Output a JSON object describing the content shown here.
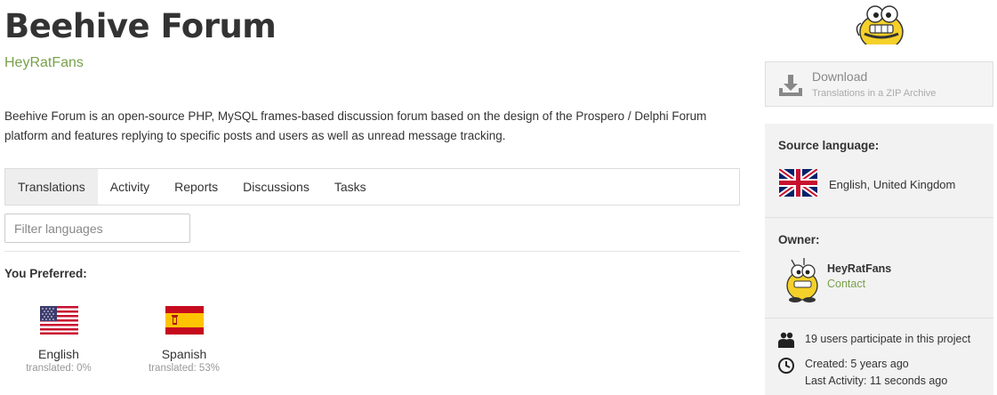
{
  "project": {
    "title": "Beehive Forum",
    "owner": "HeyRatFans",
    "description": "Beehive Forum is an open-source PHP, MySQL frames-based discussion forum based on the design of the Prospero / Delphi Forum platform and features replying to specific posts and users as well as unread message tracking."
  },
  "tabs": [
    {
      "label": "Translations",
      "active": true
    },
    {
      "label": "Activity"
    },
    {
      "label": "Reports"
    },
    {
      "label": "Discussions"
    },
    {
      "label": "Tasks"
    }
  ],
  "filter": {
    "placeholder": "Filter languages",
    "value": ""
  },
  "preferred": {
    "heading": "You Preferred:",
    "languages": [
      {
        "name": "English",
        "progress": "translated: 0%",
        "flag_icon": "us-flag-icon"
      },
      {
        "name": "Spanish",
        "progress": "translated: 53%",
        "flag_icon": "es-flag-icon"
      }
    ]
  },
  "download": {
    "title": "Download",
    "subtitle": "Translations in a ZIP Archive"
  },
  "sidebar": {
    "source_heading": "Source language:",
    "source_language": "English, United Kingdom",
    "owner_heading": "Owner:",
    "owner_name": "HeyRatFans",
    "contact_label": "Contact",
    "participants": "19 users participate in this project",
    "created": "Created: 5 years ago",
    "last_activity": "Last Activity: 11 seconds ago"
  },
  "colors": {
    "accent_green": "#79a14a",
    "panel_bg": "#f2f2f2",
    "active_tab_bg": "#eeeeee"
  }
}
